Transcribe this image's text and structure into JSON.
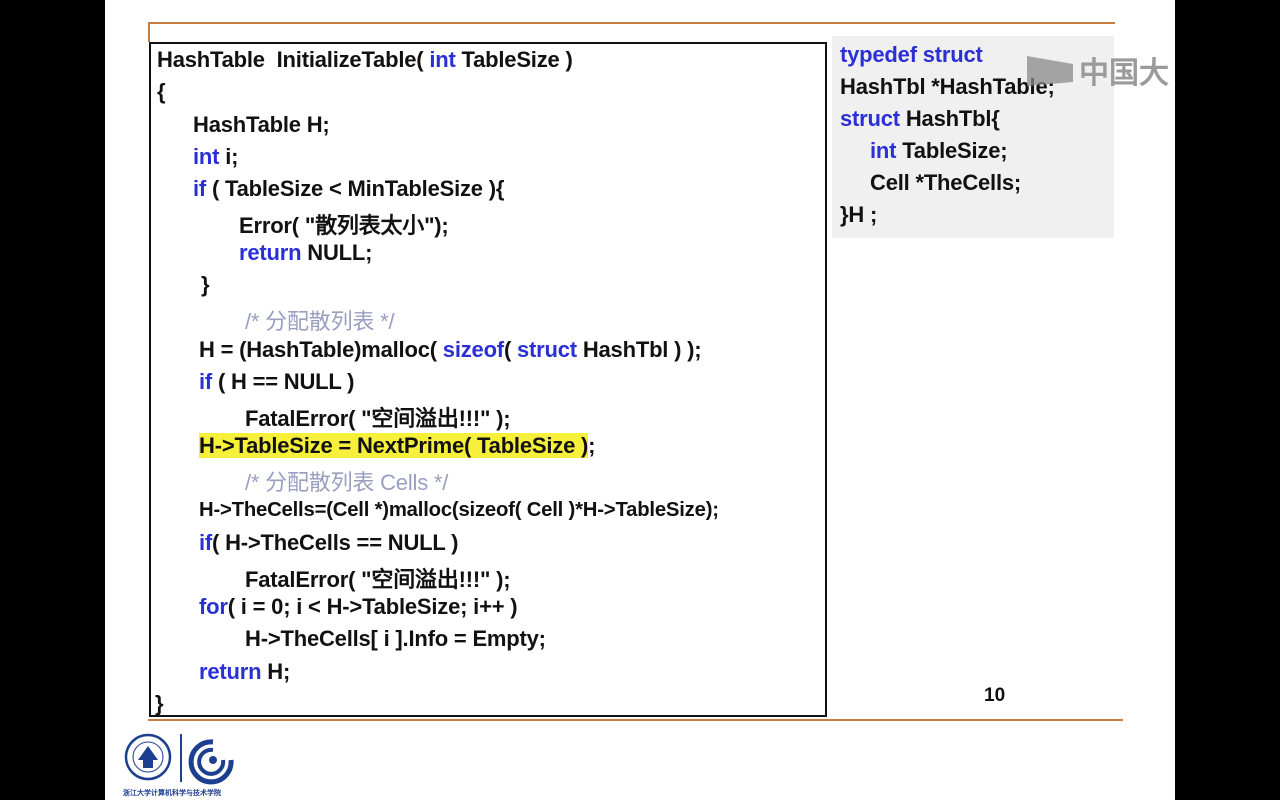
{
  "slide": {
    "page_number": "10",
    "watermark_text": "中国大",
    "footer_caption": "浙江大学计算机科学与技术学院",
    "code_lines": [
      [
        {
          "t": "HashTable  InitializeTable( "
        },
        {
          "t": "int",
          "k": "kw"
        },
        {
          "t": " TableSize )"
        }
      ],
      [
        {
          "t": "{"
        }
      ],
      [
        {
          "t": "HashTable H;"
        }
      ],
      [
        {
          "t": "int",
          "k": "kw"
        },
        {
          "t": " i;"
        }
      ],
      [
        {
          "t": "if",
          "k": "kw"
        },
        {
          "t": " ( TableSize < MinTableSize ){"
        }
      ],
      [
        {
          "t": "Error( \"散列表太小\");"
        }
      ],
      [
        {
          "t": "return",
          "k": "kw"
        },
        {
          "t": " NULL;"
        }
      ],
      [
        {
          "t": "}"
        }
      ],
      [
        {
          "t": "/* 分配散列表 */",
          "k": "cm"
        }
      ],
      [
        {
          "t": "H = (HashTable)malloc( "
        },
        {
          "t": "sizeof",
          "k": "kw"
        },
        {
          "t": "( "
        },
        {
          "t": "struct",
          "k": "kw"
        },
        {
          "t": " HashTbl ) );"
        }
      ],
      [
        {
          "t": "if",
          "k": "kw"
        },
        {
          "t": " ( H == NULL )"
        }
      ],
      [
        {
          "t": "FatalError( \"空间溢出!!!\" );"
        }
      ],
      [
        {
          "t": "H->TableSize = NextPrime( TableSize )",
          "k": "hl"
        },
        {
          "t": ";"
        }
      ],
      [
        {
          "t": "/* 分配散列表 Cells */",
          "k": "cm"
        }
      ],
      [
        {
          "t": "H->TheCells=(Cell *)malloc(sizeof( Cell )*H->TableSize);"
        }
      ],
      [
        {
          "t": "if",
          "k": "kw"
        },
        {
          "t": "( H->TheCells == NULL )"
        }
      ],
      [
        {
          "t": "FatalError( \"空间溢出!!!\" );"
        }
      ],
      [
        {
          "t": "for",
          "k": "kw"
        },
        {
          "t": "( i = 0; i < H->TableSize; i++ )"
        }
      ],
      [
        {
          "t": "H->TheCells[ i ].Info = Empty;"
        }
      ],
      [
        {
          "t": "return",
          "k": "kw"
        },
        {
          "t": " H;"
        }
      ],
      [
        {
          "t": "}"
        }
      ]
    ],
    "def_lines": [
      [
        {
          "t": "typedef struct",
          "k": "kw"
        }
      ],
      [
        {
          "t": "HashTbl *HashTable;"
        }
      ],
      [
        {
          "t": "struct",
          "k": "kw"
        },
        {
          "t": " HashTbl{"
        }
      ],
      [
        {
          "t": "int",
          "k": "kw"
        },
        {
          "t": " TableSize;"
        }
      ],
      [
        {
          "t": "Cell *TheCells;"
        }
      ],
      [
        {
          "t": "}H ;"
        }
      ]
    ]
  },
  "colors": {
    "keyword": "#2a2fd6",
    "comment": "#9a9fc0",
    "highlight": "#f6f03a",
    "rule": "#c87d3e"
  }
}
